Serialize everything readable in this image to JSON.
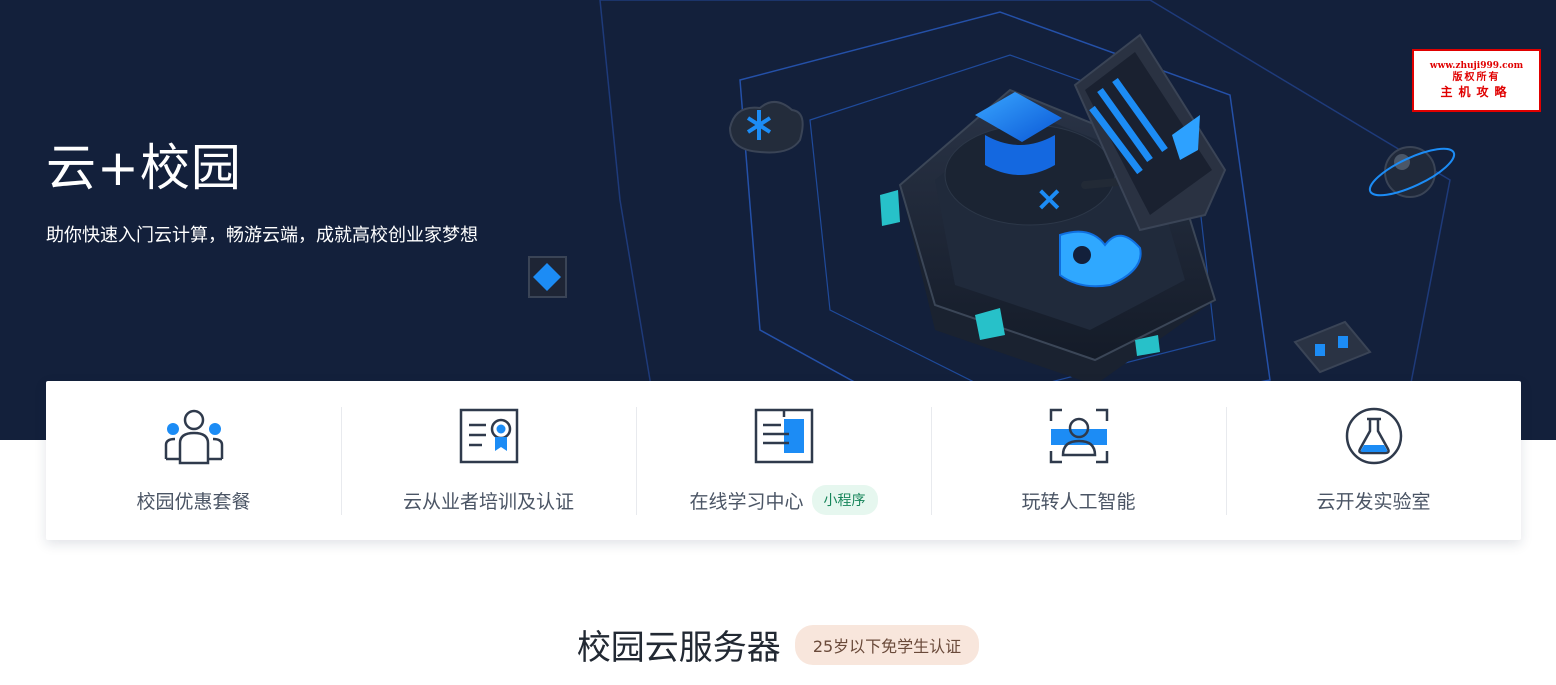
{
  "hero": {
    "title": "云+校园",
    "subtitle": "助你快速入门云计算，畅游云端，成就高校创业家梦想"
  },
  "watermark": {
    "line1": "www.zhuji999.com",
    "line2": "版权所有",
    "line3": "主机攻略"
  },
  "features": [
    {
      "label": "校园优惠套餐",
      "icon": "people-icon"
    },
    {
      "label": "云从业者培训及认证",
      "icon": "certificate-icon"
    },
    {
      "label": "在线学习中心",
      "icon": "book-icon",
      "tag": "小程序"
    },
    {
      "label": "玩转人工智能",
      "icon": "face-scan-icon"
    },
    {
      "label": "云开发实验室",
      "icon": "flask-icon"
    }
  ],
  "section": {
    "title": "校园云服务器",
    "badge": "25岁以下免学生认证"
  },
  "colors": {
    "hero_bg": "#13203b",
    "accent_blue": "#1c8cf5",
    "icon_stroke": "#2f3a4c"
  }
}
